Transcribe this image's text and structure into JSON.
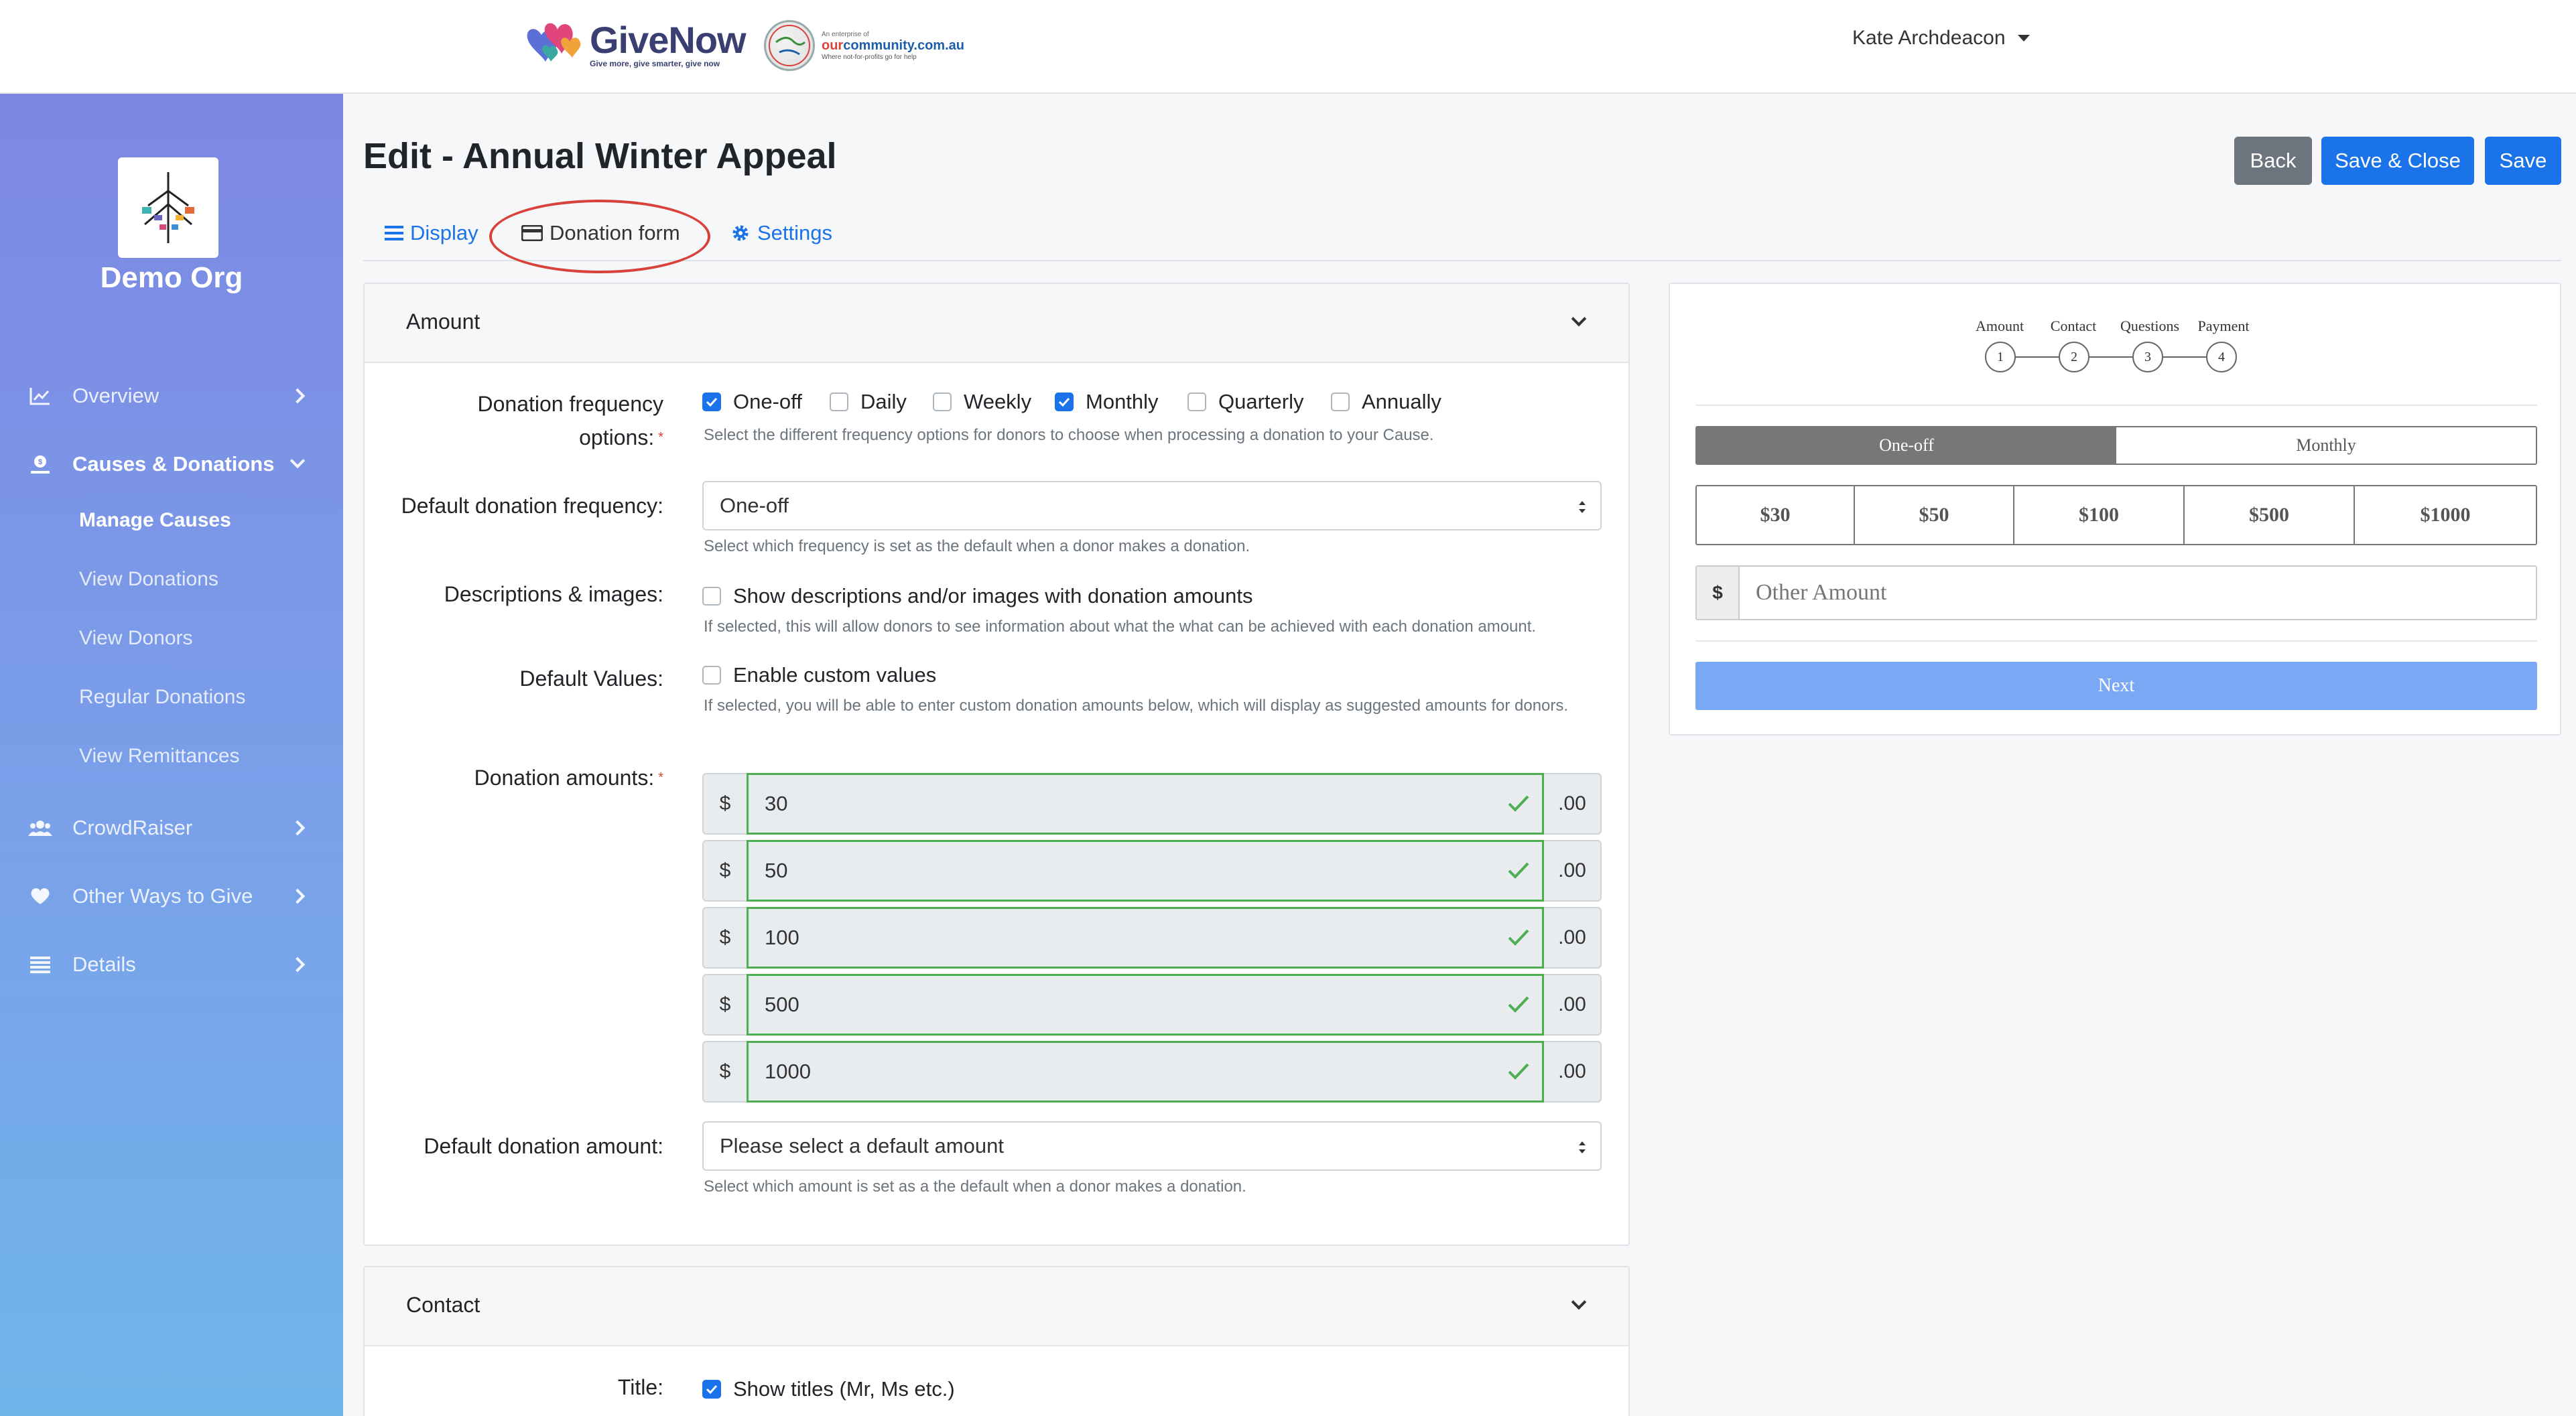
{
  "header": {
    "brand_name": "GiveNow",
    "brand_tagline": "Give more, give smarter, give now",
    "partner_small": "An enterprise of",
    "partner_name_a": "our",
    "partner_name_b": "community.com.au",
    "partner_tagline": "Where not-for-profits go for help",
    "user_name": "Kate Archdeacon"
  },
  "sidebar": {
    "org_name": "Demo Org",
    "nav": [
      {
        "label": "Overview"
      },
      {
        "label": "Causes & Donations"
      },
      {
        "label": "CrowdRaiser"
      },
      {
        "label": "Other Ways to Give"
      },
      {
        "label": "Details"
      }
    ],
    "sub": [
      {
        "label": "Manage Causes"
      },
      {
        "label": "View Donations"
      },
      {
        "label": "View Donors"
      },
      {
        "label": "Regular Donations"
      },
      {
        "label": "View Remittances"
      }
    ]
  },
  "page": {
    "title": "Edit - Annual Winter Appeal",
    "buttons": {
      "back": "Back",
      "save_close": "Save & Close",
      "save": "Save"
    },
    "tabs": [
      {
        "label": "Display"
      },
      {
        "label": "Donation form"
      },
      {
        "label": "Settings"
      }
    ]
  },
  "amount_section": {
    "title": "Amount",
    "freq_label_1": "Donation frequency",
    "freq_label_2": "options:",
    "freq_options": [
      {
        "label": "One-off",
        "checked": true
      },
      {
        "label": "Daily",
        "checked": false
      },
      {
        "label": "Weekly",
        "checked": false
      },
      {
        "label": "Monthly",
        "checked": true
      },
      {
        "label": "Quarterly",
        "checked": false
      },
      {
        "label": "Annually",
        "checked": false
      }
    ],
    "freq_help": "Select the different frequency options for donors to choose when processing a donation to your Cause.",
    "default_freq_label": "Default donation frequency:",
    "default_freq_value": "One-off",
    "default_freq_help": "Select which frequency is set as the default when a donor makes a donation.",
    "desc_label": "Descriptions & images:",
    "desc_checkbox": "Show descriptions and/or images with donation amounts",
    "desc_help": "If selected, this will allow donors to see information about what the what can be achieved with each donation amount.",
    "defaults_label": "Default Values:",
    "defaults_checkbox": "Enable custom values",
    "defaults_help": "If selected, you will be able to enter custom donation amounts below, which will display as suggested amounts for donors.",
    "amounts_label": "Donation amounts:",
    "currency": "$",
    "cents": ".00",
    "amounts": [
      "30",
      "50",
      "100",
      "500",
      "1000"
    ],
    "default_amount_label": "Default donation amount:",
    "default_amount_value": "Please select a default amount",
    "default_amount_help": "Select which amount is set as a the default when a donor makes a donation."
  },
  "contact_section": {
    "title": "Contact",
    "title_label": "Title:",
    "title_checkbox": "Show titles (Mr, Ms etc.)"
  },
  "preview": {
    "steps": [
      {
        "label": "Amount",
        "num": "1"
      },
      {
        "label": "Contact",
        "num": "2"
      },
      {
        "label": "Questions",
        "num": "3"
      },
      {
        "label": "Payment",
        "num": "4"
      }
    ],
    "freq": [
      "One-off",
      "Monthly"
    ],
    "amounts": [
      "$30",
      "$50",
      "$100",
      "$500",
      "$1000"
    ],
    "currency": "$",
    "other_placeholder": "Other Amount",
    "next": "Next"
  },
  "colors": {
    "primary": "#1a73e8",
    "secondary": "#6c757d",
    "valid": "#4caf50",
    "annotation": "#d9423a"
  }
}
